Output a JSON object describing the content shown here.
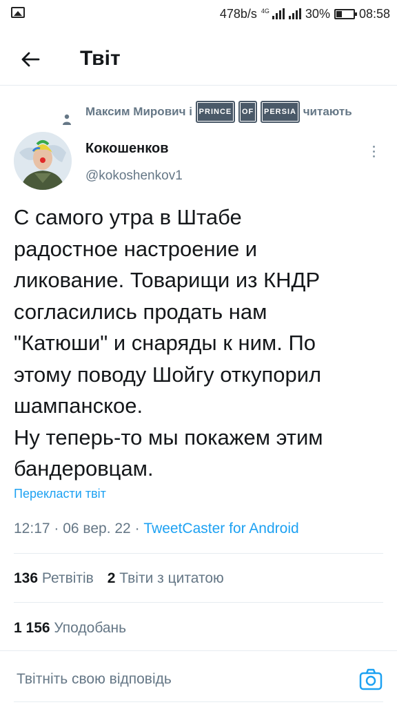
{
  "status_bar": {
    "speed": "478b/s",
    "network": "4G",
    "battery": "30%",
    "time": "08:58"
  },
  "header": {
    "title": "Твіт"
  },
  "retweeted_by": {
    "name": "Максим Мирович",
    "joiner": "і",
    "pill_1": "PRINCE",
    "pill_2": "OF",
    "pill_3": "PERSIA",
    "suffix": "читають"
  },
  "author": {
    "name": "Кокошенков",
    "handle": "@kokoshenkov1"
  },
  "tweet": {
    "text": "С самого утра в Штабе\nрадостное настроение и\nликование. Товарищи из КНДР\nсогласились продать нам\n\"Катюши\" и снаряды к ним. По\nэтому поводу Шойгу откупорил\nшампанское.\nНу теперь-то мы покажем этим\nбандеровцам.",
    "translate_label": "Перекласти твіт",
    "time": "12:17",
    "date": "06 вер. 22",
    "source": "TweetCaster for Android"
  },
  "stats": {
    "retweets_count": "136",
    "retweets_label": "Ретвітів",
    "quotes_count": "2",
    "quotes_label": "Твіти з цитатою",
    "likes_count": "1 156",
    "likes_label": "Уподобань"
  },
  "reply": {
    "placeholder": "Твітніть свою відповідь"
  },
  "icons": {
    "back": "arrow-left-icon",
    "retweeted": "person-icon",
    "more": "more-vertical-icon",
    "camera": "camera-icon"
  },
  "colors": {
    "accent": "#1da1f2",
    "secondary_text": "#657786",
    "primary_text": "#14171a"
  }
}
